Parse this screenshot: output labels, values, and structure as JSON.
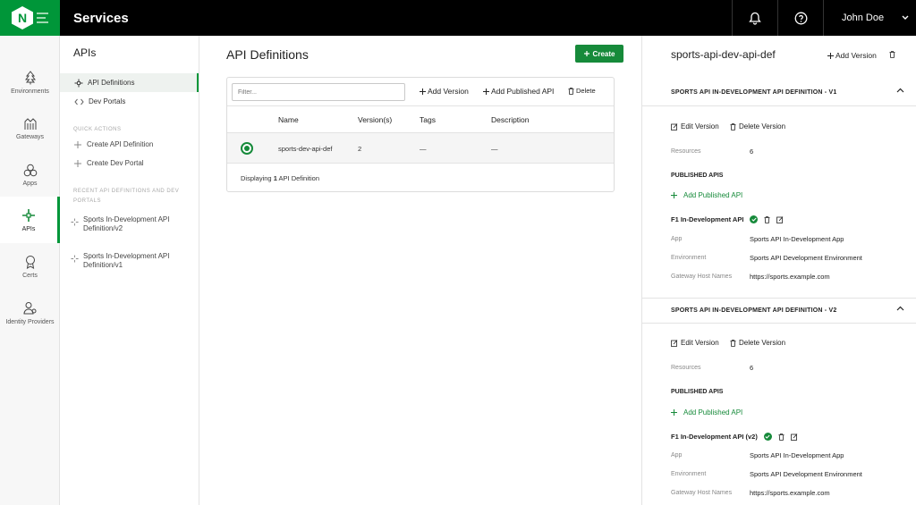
{
  "app": {
    "brand_letter": "N",
    "title": "Services",
    "user": "John Doe"
  },
  "rail": [
    {
      "label": "Environments",
      "icon": "tree-icon"
    },
    {
      "label": "Gateways",
      "icon": "gateway-icon"
    },
    {
      "label": "Apps",
      "icon": "apps-icon"
    },
    {
      "label": "APIs",
      "icon": "api-icon"
    },
    {
      "label": "Certs",
      "icon": "cert-icon"
    },
    {
      "label": "Identity Providers",
      "icon": "identity-icon"
    }
  ],
  "subnav": {
    "title": "APIs",
    "items": [
      "API Definitions",
      "Dev Portals"
    ],
    "quick_actions_label": "QUICK ACTIONS",
    "quick_actions": [
      "Create API Definition",
      "Create Dev Portal"
    ],
    "recent_label": "RECENT API DEFINITIONS AND DEV PORTALS",
    "recent": [
      {
        "line1": "Sports In-Development API",
        "line2": "Definition/v2"
      },
      {
        "line1": "Sports In-Development API",
        "line2": "Definition/v1"
      }
    ]
  },
  "main": {
    "title": "API Definitions",
    "create_label": "Create",
    "filter_placeholder": "Filter...",
    "tools": {
      "add_version": "Add Version",
      "add_published": "Add Published API",
      "delete": "Delete"
    },
    "columns": [
      "Name",
      "Version(s)",
      "Tags",
      "Description"
    ],
    "rows": [
      {
        "name": "sports-dev-api-def",
        "versions": "2",
        "tags": "—",
        "description": "—"
      }
    ],
    "footer_prefix": "Displaying",
    "footer_count": "1",
    "footer_suffix": "API Definition"
  },
  "detail": {
    "title": "sports-api-dev-api-def",
    "add_version": "Add Version",
    "edit_version": "Edit Version",
    "delete_version": "Delete Version",
    "resources_label": "Resources",
    "published_label": "PUBLISHED APIS",
    "add_published": "Add Published API",
    "app_label": "App",
    "env_label": "Environment",
    "host_label": "Gateway Host Names",
    "sections": [
      {
        "title": "SPORTS API IN-DEVELOPMENT API DEFINITION - V1",
        "resources": "6",
        "api_name": "F1 In-Development API",
        "app": "Sports API In-Development App",
        "environment": "Sports API Development Environment",
        "host": "https://sports.example.com"
      },
      {
        "title": "SPORTS API IN-DEVELOPMENT API DEFINITION - V2",
        "resources": "6",
        "api_name": "F1 In-Development API (v2)",
        "app": "Sports API In-Development App",
        "environment": "Sports API Development Environment",
        "host": "https://sports.example.com"
      }
    ]
  },
  "colors": {
    "brand": "#009639",
    "accent": "#168a3a",
    "topbar": "#000000"
  }
}
